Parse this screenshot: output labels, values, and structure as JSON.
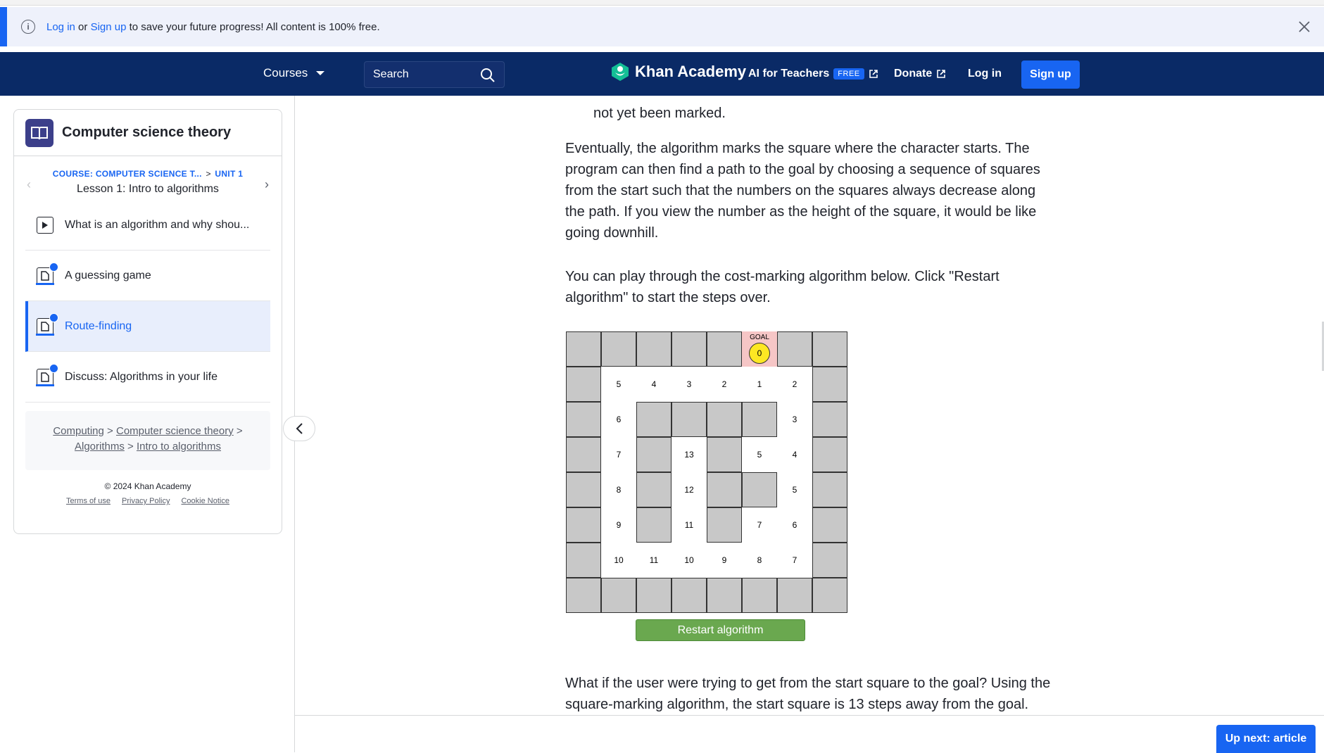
{
  "banner": {
    "login_link": "Log in",
    "or_text": " or ",
    "signup_link": "Sign up",
    "message": " to save your future progress! All content is 100% free."
  },
  "nav": {
    "courses": "Courses",
    "search_placeholder": "Search",
    "logo": "Khan Academy",
    "ai_teachers": "AI for Teachers",
    "free_badge": "FREE",
    "donate": "Donate",
    "login": "Log in",
    "signup": "Sign up"
  },
  "sidebar": {
    "course_title": "Computer science theory",
    "breadcrumb_course": "COURSE: COMPUTER SCIENCE T...",
    "breadcrumb_sep": ">",
    "breadcrumb_unit": "UNIT 1",
    "lesson_title": "Lesson 1: Intro to algorithms",
    "items": [
      {
        "label": "What is an algorithm and why shou...",
        "type": "video",
        "done": false,
        "active": false
      },
      {
        "label": "A guessing game",
        "type": "article",
        "done": true,
        "active": false
      },
      {
        "label": "Route-finding",
        "type": "article",
        "done": true,
        "active": true
      },
      {
        "label": "Discuss: Algorithms in your life",
        "type": "article",
        "done": true,
        "active": false
      }
    ],
    "crumbs": {
      "computing": "Computing",
      "cs_theory": "Computer science theory",
      "algorithms": "Algorithms",
      "intro": "Intro to algorithms",
      "sep": ">"
    },
    "copyright": "© 2024 Khan Academy",
    "terms": "Terms of use",
    "privacy": "Privacy Policy",
    "cookie": "Cookie Notice"
  },
  "article": {
    "cropped_line": "not yet been marked.",
    "para1": "Eventually, the algorithm marks the square where the character starts. The program can then find a path to the goal by choosing a sequence of squares from the start such that the numbers on the squares always decrease along the path. If you view the number as the height of the square, it would be like going downhill.",
    "para2": "You can play through the cost-marking algorithm below. Click \"Restart algorithm\" to start the steps over.",
    "para3": "What if the user were trying to get from the start square to the goal? Using the square-marking algorithm, the start square is 13 steps away from the goal."
  },
  "grid": {
    "goal_label": "GOAL",
    "goal_value": "0",
    "rows": [
      [
        "W",
        "W",
        "W",
        "W",
        "W",
        "G",
        "W",
        "W"
      ],
      [
        "W",
        "5",
        "4",
        "3",
        "2",
        "1",
        "2",
        "W"
      ],
      [
        "W",
        "6",
        "W",
        "W",
        "W",
        "W",
        "3",
        "W"
      ],
      [
        "W",
        "7",
        "W",
        "13",
        "W",
        "5",
        "4",
        "W"
      ],
      [
        "W",
        "8",
        "W",
        "12",
        "W",
        "W",
        "5",
        "W"
      ],
      [
        "W",
        "9",
        "W",
        "11",
        "W",
        "7",
        "6",
        "W"
      ],
      [
        "W",
        "10",
        "11",
        "10",
        "9",
        "8",
        "7",
        "W"
      ],
      [
        "W",
        "W",
        "W",
        "W",
        "W",
        "W",
        "W",
        "W"
      ]
    ]
  },
  "restart_button": "Restart algorithm",
  "up_next": "Up next: article",
  "colors": {
    "accent": "#1865f2",
    "nav_bg": "#0a2a66",
    "wall": "#c8c8c8",
    "goal": "#f6c6c6",
    "restart": "#6aa84f"
  }
}
